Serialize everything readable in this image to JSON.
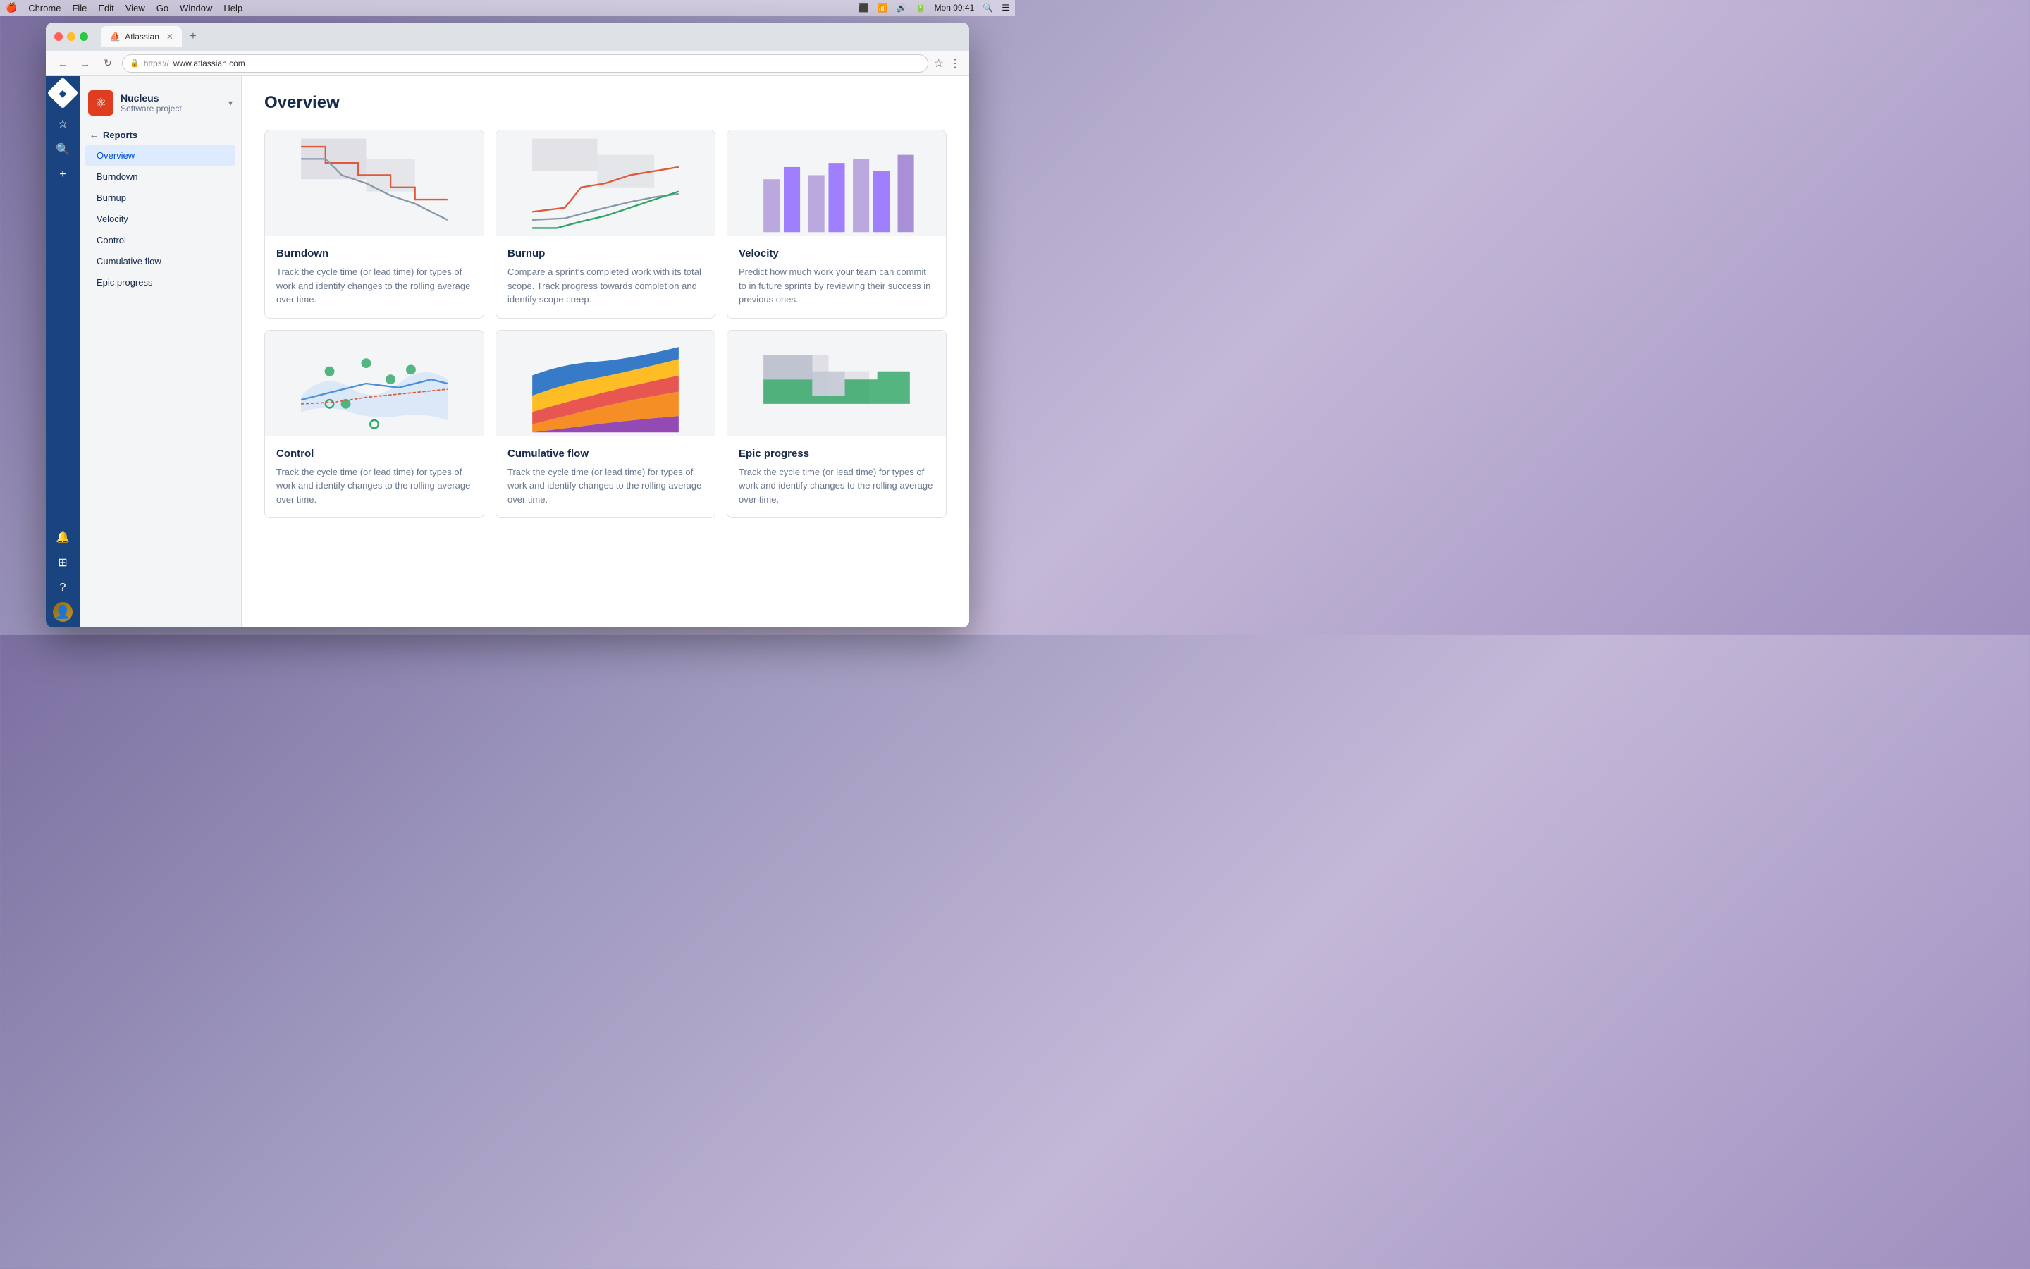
{
  "menubar": {
    "apple": "🍎",
    "menus": [
      "Chrome",
      "File",
      "Edit",
      "View",
      "Go",
      "Window",
      "Help"
    ],
    "time": "Mon 09:41",
    "icons": [
      "cast",
      "wifi",
      "volume",
      "battery"
    ]
  },
  "browser": {
    "tab": {
      "favicon": "atlassian",
      "title": "Atlassian"
    },
    "url": {
      "protocol": "https://",
      "domain": "www.atlassian.com"
    }
  },
  "sidebar": {
    "project": {
      "name": "Nucleus",
      "type": "Software project",
      "icon": "⚛"
    },
    "back_label": "Reports",
    "nav_items": [
      {
        "id": "overview",
        "label": "Overview",
        "active": true
      },
      {
        "id": "burndown",
        "label": "Burndown",
        "active": false
      },
      {
        "id": "burnup",
        "label": "Burnup",
        "active": false
      },
      {
        "id": "velocity",
        "label": "Velocity",
        "active": false
      },
      {
        "id": "control",
        "label": "Control",
        "active": false
      },
      {
        "id": "cumulative-flow",
        "label": "Cumulative flow",
        "active": false
      },
      {
        "id": "epic-progress",
        "label": "Epic progress",
        "active": false
      }
    ]
  },
  "main": {
    "title": "Overview",
    "cards": [
      {
        "id": "burndown",
        "title": "Burndown",
        "desc": "Track the cycle time (or lead time) for types of work and identify changes to the rolling average over time.",
        "chart_type": "burndown"
      },
      {
        "id": "burnup",
        "title": "Burnup",
        "desc": "Compare a sprint's completed work with its total scope. Track progress towards completion and identify scope creep.",
        "chart_type": "burnup"
      },
      {
        "id": "velocity",
        "title": "Velocity",
        "desc": "Predict how much work your team can commit to in future sprints by reviewing their success in previous ones.",
        "chart_type": "velocity"
      },
      {
        "id": "control",
        "title": "Control",
        "desc": "Track the cycle time (or lead time) for types of work and identify changes to the rolling average over time.",
        "chart_type": "control"
      },
      {
        "id": "cumulative-flow",
        "title": "Cumulative flow",
        "desc": "Track the cycle time (or lead time) for types of work and identify changes to the rolling average over time.",
        "chart_type": "cumulative"
      },
      {
        "id": "epic-progress",
        "title": "Epic progress",
        "desc": "Track the cycle time (or lead time) for types of work and identify changes to the rolling average over time.",
        "chart_type": "epic"
      }
    ]
  }
}
